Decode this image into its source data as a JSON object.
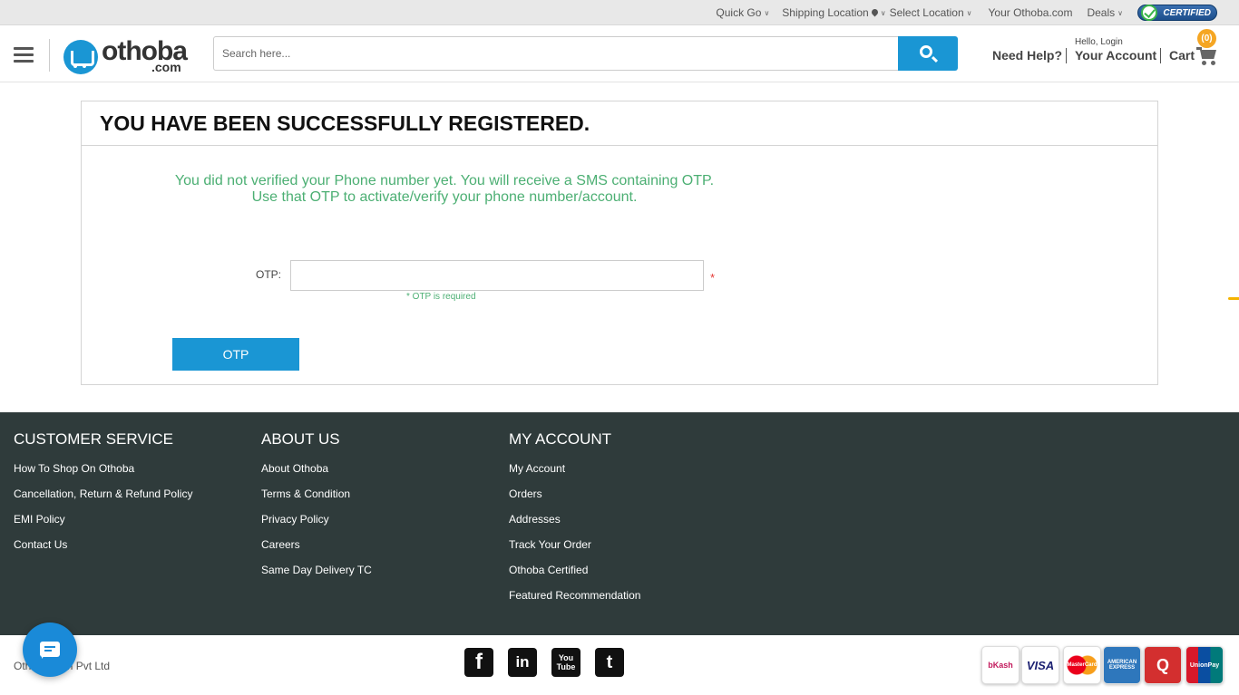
{
  "topbar": {
    "quick_go": "Quick Go",
    "shipping_location": "Shipping Location",
    "select_location": "Select Location",
    "your_othoba": "Your Othoba.com",
    "deals": "Deals",
    "certified": "CERTIFIED"
  },
  "header": {
    "logo_word": "othoba",
    "logo_dotcom": ".com",
    "search_placeholder": "Search here...",
    "need_help": "Need Help?",
    "hello_login": "Hello, Login",
    "your_account": "Your Account",
    "cart_label": "Cart",
    "cart_count": "(0)"
  },
  "main": {
    "title": "YOU HAVE BEEN SUCCESSFULLY REGISTERED.",
    "notice_line1": "You did not verified your Phone number yet. You will receive a SMS containing OTP.",
    "notice_line2": "Use that OTP to activate/verify your phone number/account.",
    "otp_label": "OTP:",
    "otp_value": "",
    "required_star": "*",
    "required_msg": "* OTP is required",
    "otp_button": "OTP"
  },
  "footer": {
    "customer_service": {
      "heading": "CUSTOMER SERVICE",
      "links": [
        "How To Shop On Othoba",
        "Cancellation, Return & Refund Policy",
        "EMI Policy",
        "Contact Us"
      ]
    },
    "about_us": {
      "heading": "ABOUT US",
      "links": [
        "About Othoba",
        "Terms & Condition",
        "Privacy Policy",
        "Careers",
        "Same Day Delivery TC"
      ]
    },
    "my_account": {
      "heading": "MY ACCOUNT",
      "links": [
        "My Account",
        "Orders",
        "Addresses",
        "Track Your Order",
        "Othoba Certified",
        "Featured Recommendation"
      ]
    },
    "copyright": "Othoba.com Pvt Ltd",
    "social": {
      "facebook": "f",
      "linkedin": "in",
      "youtube": "You Tube",
      "twitter": "t"
    },
    "payments": [
      "bKash",
      "VISA",
      "MasterCard",
      "AMERICAN EXPRESS",
      "Q",
      "UnionPay"
    ]
  },
  "colors": {
    "accent": "#1a96d4",
    "footer_bg": "#2f3b3b",
    "notice_green": "#4caf73",
    "cart_badge": "#f5a623"
  }
}
